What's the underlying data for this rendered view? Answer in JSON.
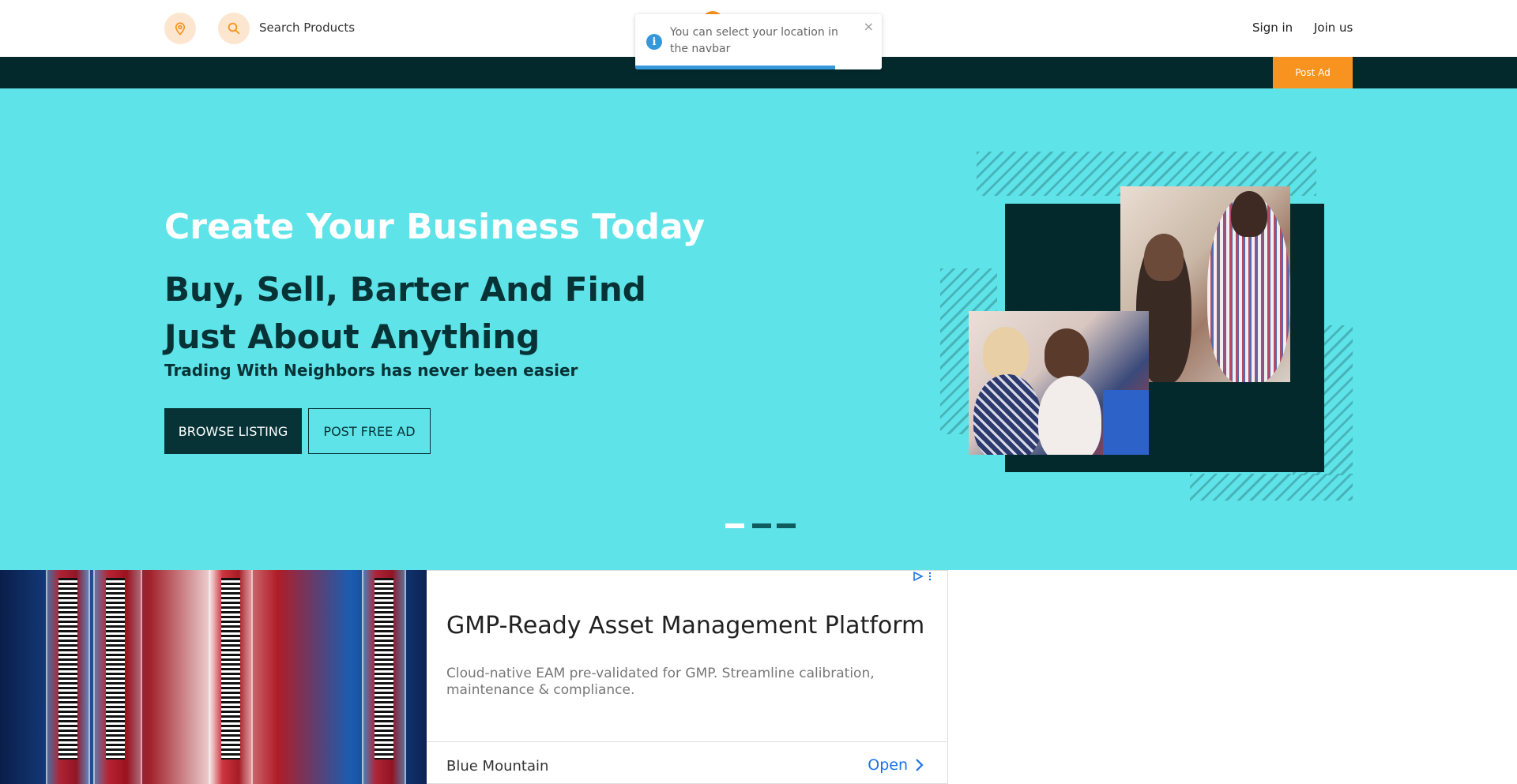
{
  "header": {
    "search_label": "Search Products",
    "sign_in": "Sign in",
    "join_us": "Join us",
    "post_ad": "Post Ad",
    "location_icon": "map-pin-icon",
    "search_icon": "search-icon"
  },
  "toast": {
    "message": "You can select your location in the navbar",
    "close": "×",
    "icon": "i",
    "progress": 0.81
  },
  "hero": {
    "title": "Create Your Business Today",
    "subtitle": "Buy, Sell, Barter And Find Just About Anything",
    "tagline": "Trading With Neighbors has never been easier",
    "browse_button": "BROWSE LISTING",
    "post_button": "POST FREE AD",
    "active_slide": 1,
    "slide_count": 3
  },
  "ad": {
    "title": "GMP-Ready Asset Management Platform",
    "description": "Cloud-native EAM pre-validated for GMP. Streamline calibration, maintenance & compliance.",
    "advertiser": "Blue Mountain",
    "cta": "Open"
  },
  "colors": {
    "accent": "#f7931e",
    "dark": "#04292c",
    "hero_bg": "#5ee3e8",
    "info": "#3498db"
  }
}
